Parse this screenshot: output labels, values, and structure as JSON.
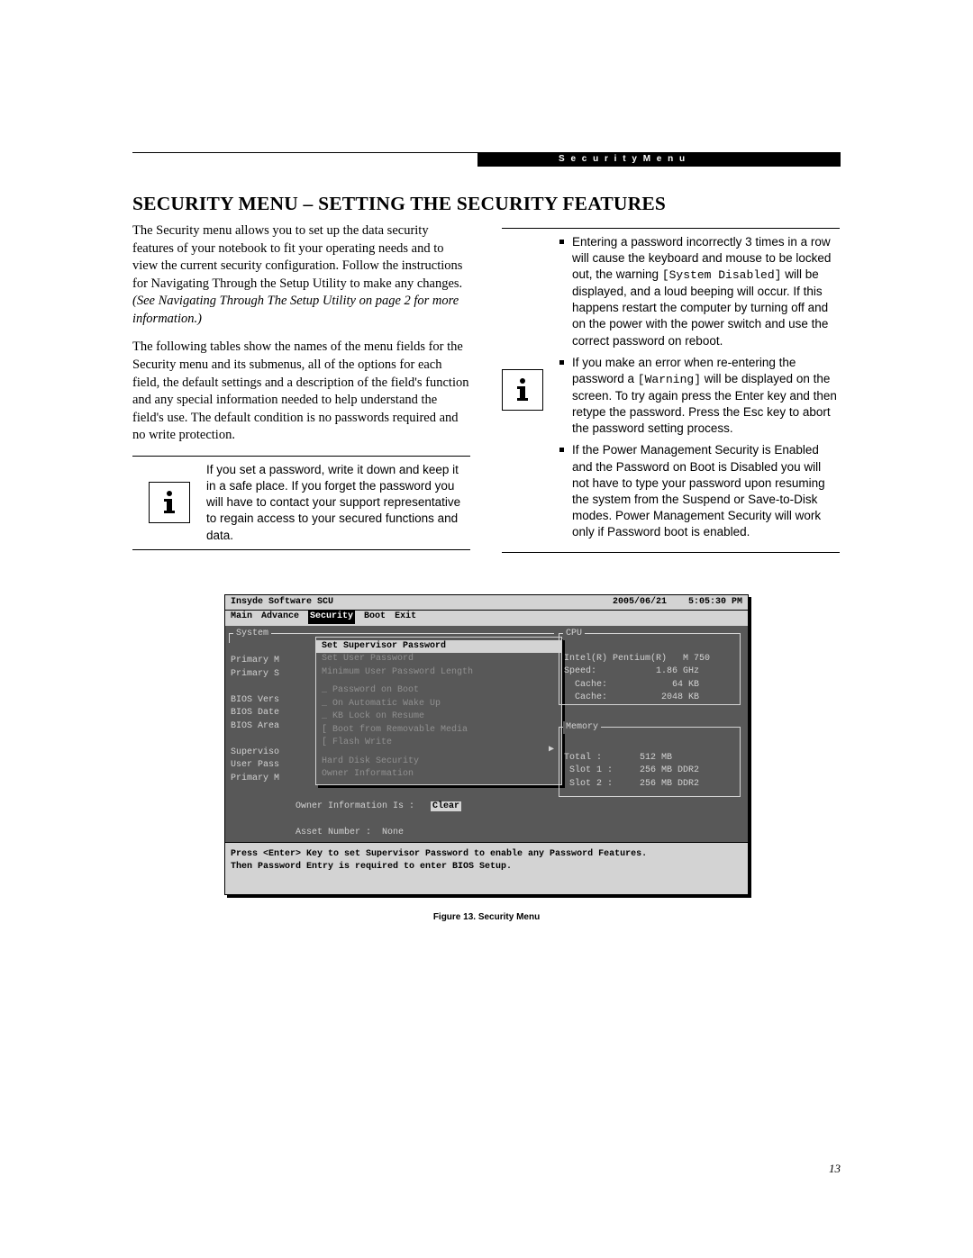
{
  "header": {
    "running": "S e c u r i t y   M e n u"
  },
  "title": "SECURITY MENU – SETTING THE SECURITY FEATURES",
  "col1": {
    "p1a": "The Security menu allows you to set up the data security features of your notebook to fit your operating needs and to view the current security configuration. Follow the instructions for Navigating Through the Setup Utility to make any changes. ",
    "p1b": "(See Navigating Through The Setup Utility on page 2 for more information.)",
    "p2": "The following tables show the names of the menu fields for the Security menu and its submenus, all of the options for each field, the default settings and a description of the field's function and any special information needed to help understand the field's use. The default condition is no passwords required and no write protection.",
    "note": "If you set a password, write it down and keep it in a safe place. If you forget the password you will have to contact your support representative to regain access to your secured functions and data."
  },
  "col2": {
    "b1a": "Entering a password incorrectly 3 times in a row will cause the keyboard and mouse to be locked out, the warning ",
    "b1code": "[System Disabled]",
    "b1b": " will be displayed, and a loud beeping will occur. If this happens restart the computer by turning off and on the power with the power switch and use the correct password on reboot.",
    "b2a": "If you make an error when re-entering the password a ",
    "b2code": "[Warning]",
    "b2b": "  will be displayed on the screen. To try again press the Enter key and then retype the password. Press the Esc key to abort the password setting process.",
    "b3": "If the Power Management Security is Enabled and the Password on Boot is Disabled you will not have to type your password upon resuming the system from the Suspend or Save-to-Disk modes. Power Management Security will work only if Password boot is enabled."
  },
  "bios": {
    "title_left": "Insyde Software SCU",
    "title_date": "2005/06/21",
    "title_time": "5:05:30 PM",
    "menu": [
      "Main",
      "Advance",
      "Security",
      "Boot",
      "Exit"
    ],
    "menu_selected": 2,
    "system_label": "System",
    "left_labels": "\nPrimary M\nPrimary S\n\nBIOS Vers\nBIOS Date\nBIOS Area\n\nSuperviso\nUser Pass\nPrimary M",
    "dropdown": [
      {
        "t": "Set Supervisor Password",
        "sel": true
      },
      {
        "t": "Set User Password"
      },
      {
        "t": "Minimum User Password Length"
      },
      {
        "blank": true
      },
      {
        "t": "  Password on Boot",
        "pre": "_"
      },
      {
        "t": "  On Automatic Wake Up",
        "pre": "_"
      },
      {
        "t": "  KB Lock on Resume",
        "pre": "_"
      },
      {
        "t": "  Boot from Removable Media",
        "pre": "["
      },
      {
        "t": "  Flash Write",
        "pre": "["
      },
      {
        "blank": true
      },
      {
        "t": "  Hard Disk Security",
        "arrow": true
      },
      {
        "t": "  Owner Information"
      }
    ],
    "cpu_label": "CPU",
    "cpu_body": "Intel(R) Pentium(R)   M 750\nSpeed:           1.86 GHz\n  Cache:            64 KB\n  Cache:          2048 KB",
    "mem_label": "Memory",
    "mem_body": "Total :       512 MB\n Slot 1 :     256 MB DDR2\n Slot 2 :     256 MB DDR2",
    "owner_l1a": "Owner Information Is :   ",
    "owner_l1b": "Clear",
    "owner_l2": "Asset Number :  None",
    "help": "Press <Enter> Key to set Supervisor Password to enable any Password Features.\nThen Password Entry is required to enter BIOS Setup."
  },
  "caption": "Figure 13.  Security Menu",
  "pagenum": "13"
}
